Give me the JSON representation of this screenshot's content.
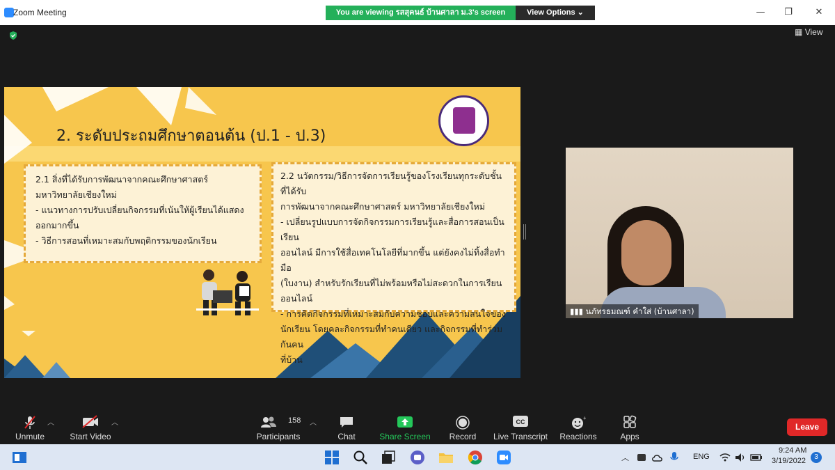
{
  "window": {
    "title": "Zoom Meeting",
    "minimize": "—",
    "restore": "❐",
    "close": "✕"
  },
  "share_banner": {
    "text": "You are viewing รสสุคนธ์ บ้านศาลา ม.3's screen",
    "view_options_label": "View Options ⌄"
  },
  "meeting": {
    "view_label": "View"
  },
  "slide": {
    "heading": "2. ระดับประถมศึกษาตอนต้น (ป.1 - ป.3)",
    "box1": {
      "line1": "2.1 สิ่งที่ได้รับการพัฒนาจากคณะศึกษาศาสตร์",
      "line2": "มหาวิทยาลัยเชียงใหม่",
      "line3": "-      แนวทางการปรับเปลี่ยนกิจกรรมที่เน้นให้ผู้เรียนได้แสดง",
      "line4": "ออกมากขึ้น",
      "line5": "- วิธีการสอนที่เหมาะสมกับพฤติกรรมของนักเรียน"
    },
    "box2": {
      "line1": "2.2 นวัตกรรม/วิธีการจัดการเรียนรู้ของโรงเรียนทุกระดับชั้นที่ได้รับ",
      "line2": "การพัฒนาจากคณะศึกษาศาสตร์ มหาวิทยาลัยเชียงใหม่",
      "line3": "- เปลี่ยนรูปแบบการจัดกิจกรรมการเรียนรู้และสื่อการสอนเป็นเรียน",
      "line4": "ออนไลน์ มีการใช้สื่อเทคโนโลยีที่มากขึ้น แต่ยังคงไม่ทิ้งสื่อทำมือ",
      "line5": "(ใบงาน) สำหรับรักเรียนที่ไม่พร้อมหรือไม่สะดวกในการเรียน",
      "line6": "ออนไลน์",
      "line7": "- การคิดกิจกรรมที่เหมาะสมกับความชอบและความสนใจของ",
      "line8": "นักเรียน โดยคละกิจกรรมที่ทำคนเดียว และกิจกรรมที่ทำร่วมกันคน",
      "line9": "ที่บ้าน"
    }
  },
  "participant_video": {
    "name": "นภัทรธมณฑ์ คำใส่ (บ้านศาลา)"
  },
  "toolbar": {
    "unmute": "Unmute",
    "start_video": "Start Video",
    "participants": "Participants",
    "participants_count": "158",
    "chat": "Chat",
    "share_screen": "Share Screen",
    "record": "Record",
    "live_transcript": "Live Transcript",
    "reactions": "Reactions",
    "apps": "Apps",
    "leave": "Leave"
  },
  "taskbar": {
    "language": "ENG",
    "time": "9:24 AM",
    "date": "3/19/2022",
    "notifications": "3"
  },
  "colors": {
    "share_green": "#24b05a",
    "leave_red": "#e02828",
    "slide_yellow": "#f7c64d",
    "share_icon_green": "#24c75a"
  }
}
